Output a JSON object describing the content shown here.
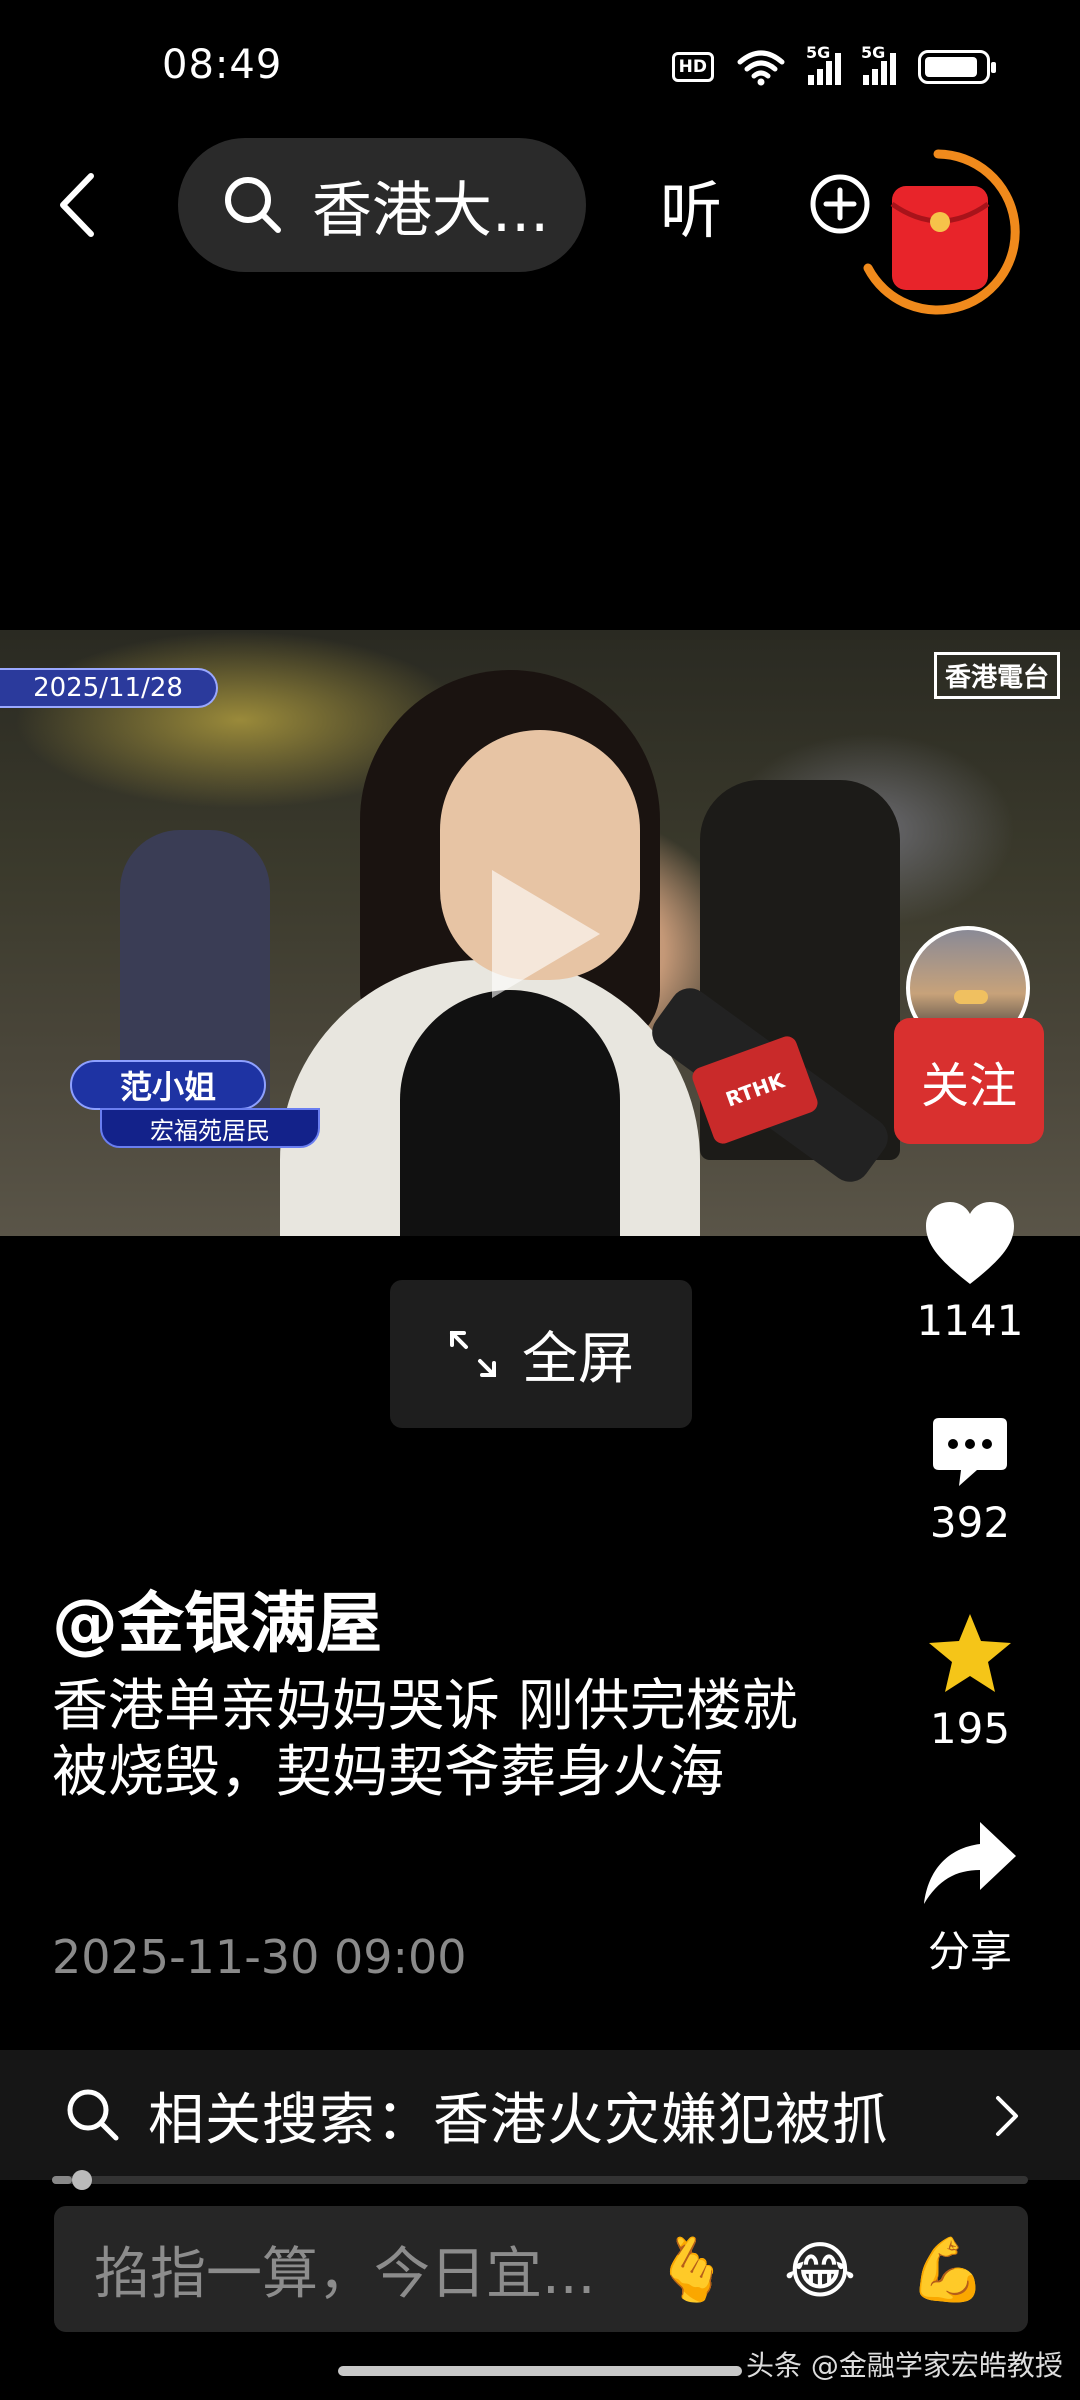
{
  "status_bar": {
    "time": "08:49",
    "hd": "HD",
    "net1": "5G",
    "net2": "5G"
  },
  "nav": {
    "search_text": "香港大...",
    "listen": "听"
  },
  "video": {
    "date_tag": "2025/11/28",
    "logo": "香港電台",
    "name_tag": "范小姐",
    "sub_tag": "宏福苑居民",
    "mic_label": "RTHK"
  },
  "rail": {
    "follow": "关注",
    "likes": "1141",
    "comments": "392",
    "favorites": "195",
    "share": "分享"
  },
  "fullscreen": "全屏",
  "post": {
    "author": "@金银满屋",
    "caption": "香港单亲妈妈哭诉 刚供完楼就被烧毁，契妈契爷葬身火海",
    "time": "2025-11-30 09:00"
  },
  "related_search": "相关搜索：香港火灾嫌犯被抓",
  "progress": {
    "fraction": 0.02
  },
  "comment": {
    "placeholder": "掐指一算，今日宜..."
  },
  "emojis": [
    "🫰",
    "😂",
    "💪"
  ],
  "watermark": "头条 @金融学家宏皓教授",
  "colors": {
    "accent": "#d9302f",
    "star": "#f5c518",
    "ring": "#f08a1c"
  }
}
